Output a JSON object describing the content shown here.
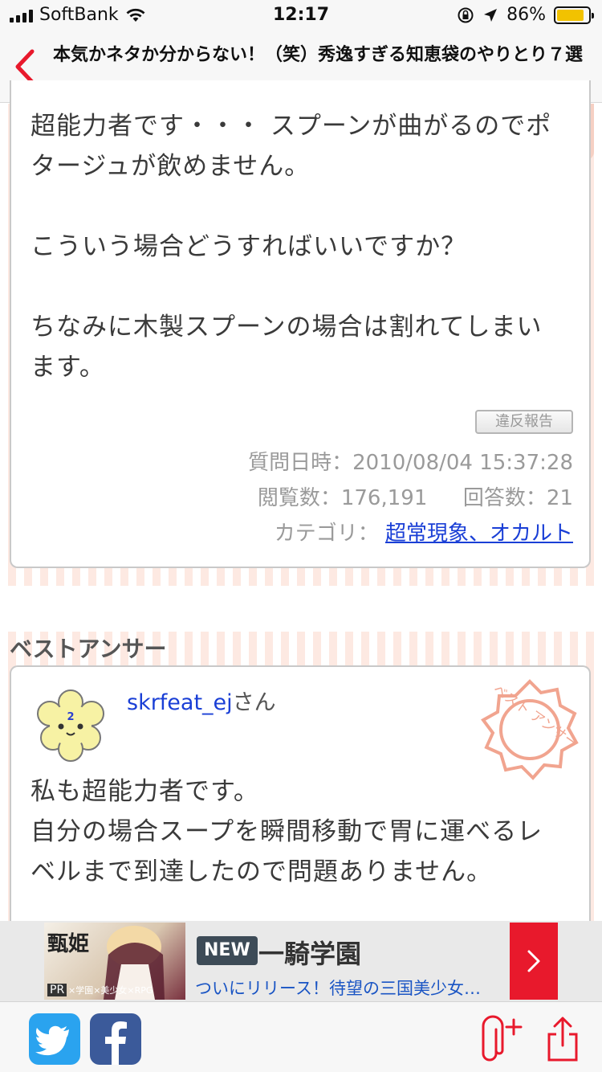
{
  "status_bar": {
    "carrier": "SoftBank",
    "time": "12:17",
    "battery_percent": "86%",
    "battery_level": 0.86
  },
  "nav": {
    "title": "本気かネタか分からない！（笑）秀逸すぎる知恵袋のやりとり７選"
  },
  "question": {
    "lines": [
      "超能力者です・・・ スプーンが曲がるのでポ",
      "タージュが飲めません。",
      "",
      "こういう場合どうすればいいですか？",
      "",
      "ちなみに木製スプーンの場合は割れてしまい",
      "ます。"
    ],
    "report_label": "違反報告",
    "date_label": "質問日時：2010/08/04 15:37:28",
    "views_label": "閲覧数：176,191",
    "answers_label": "回答数：21",
    "category_label": "カテゴリ：",
    "category_value": "超常現象、オカルト"
  },
  "best_answer": {
    "section_title": "ベストアンサー",
    "username": "skrfeat_ej",
    "honorific": "さん",
    "avatar_number": "2",
    "stamp_text": "ベスト アンサー",
    "lines": [
      "私も超能力者です。",
      "自分の場合スープを瞬間移動で胃に運べるレ",
      "ベルまで到達したので問題ありません。"
    ]
  },
  "ad": {
    "logo_text": "甄姫",
    "pr_label": "PR",
    "image_tagline": "×学園×美少女×RPG",
    "badge": "NEW",
    "title": "一騎学園",
    "description": "ついにリリース！待望の三国美少女…"
  },
  "colors": {
    "accent_red": "#e8192c",
    "link_blue": "#1a3fd6",
    "stripe_pink": "#fde9e2",
    "stamp_pink": "#f1a48f"
  }
}
